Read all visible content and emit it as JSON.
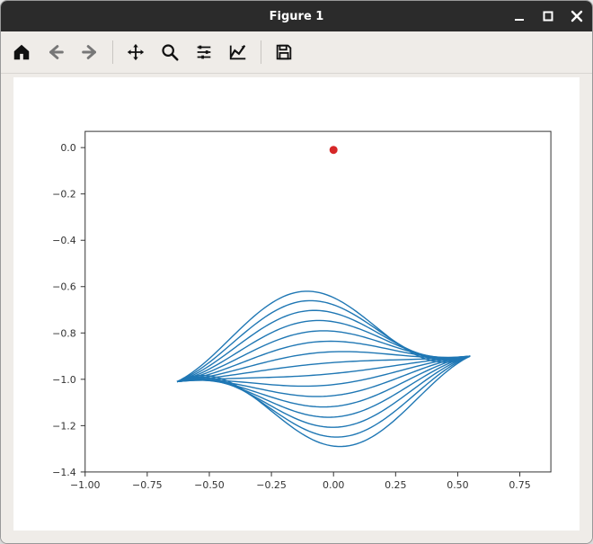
{
  "window": {
    "title": "Figure 1"
  },
  "toolbar_icons": {
    "home": "home-icon",
    "back": "back-arrow-icon",
    "forward": "forward-arrow-icon",
    "pan": "move-icon",
    "zoom": "zoom-icon",
    "configure": "sliders-icon",
    "edit": "chart-edit-icon",
    "save": "save-icon"
  },
  "chart_data": {
    "type": "line",
    "title": "",
    "xlabel": "",
    "ylabel": "",
    "xlim": [
      -1.0,
      0.875
    ],
    "ylim": [
      -1.4,
      0.07
    ],
    "xticks": [
      -1.0,
      -0.75,
      -0.5,
      -0.25,
      0.0,
      0.25,
      0.5,
      0.75
    ],
    "xtick_labels": [
      "−1.00",
      "−0.75",
      "−0.50",
      "−0.25",
      "0.00",
      "0.25",
      "0.50",
      "0.75"
    ],
    "yticks": [
      0.0,
      -0.2,
      -0.4,
      -0.6,
      -0.8,
      -1.0,
      -1.2,
      -1.4
    ],
    "ytick_labels": [
      "0.0",
      "−0.2",
      "−0.4",
      "−0.6",
      "−0.8",
      "−1.0",
      "−1.2",
      "−1.4"
    ],
    "marker": {
      "x": 0.0,
      "y": -0.01,
      "color": "#d62728"
    },
    "line_color": "#1f77b4",
    "curves": {
      "description": "16 approximately sinusoidal curves sharing endpoints near (-0.63,-1.01) and (0.55,-0.90); each curve k (k=0..15) roughly follows y = base(x) + A_k * sin(pi*(x-x0)/(x1-x0)) with base interpolating the endpoints, amplitudes spanning about -0.36..+0.36.",
      "x0": -0.63,
      "y0": -1.01,
      "x1": 0.55,
      "y1": -0.9,
      "count": 16,
      "amplitude_min": -0.36,
      "amplitude_max": 0.36
    }
  }
}
